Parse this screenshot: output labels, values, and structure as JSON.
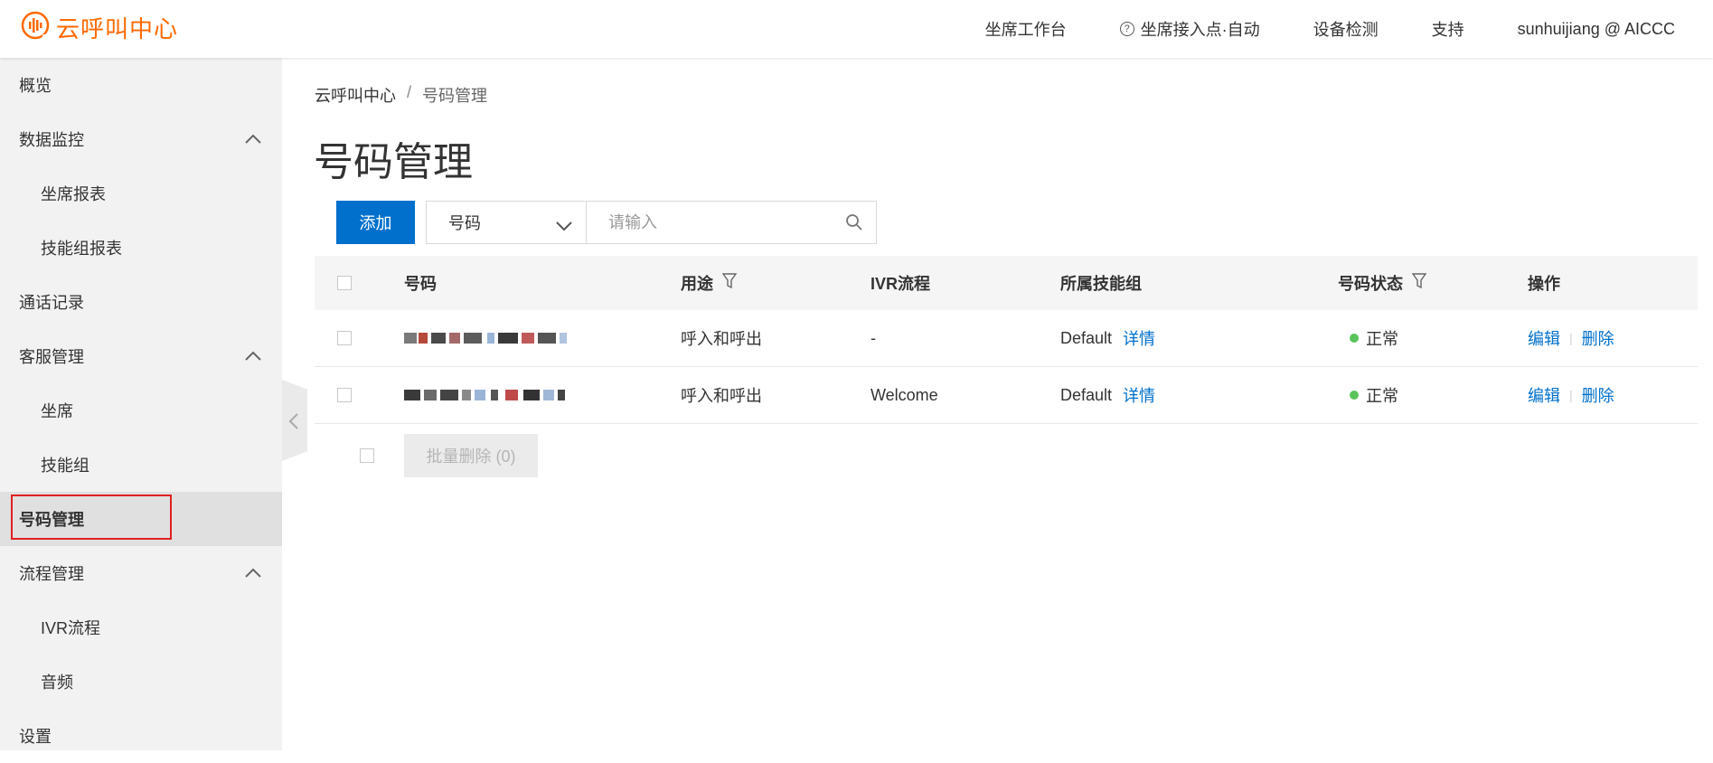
{
  "header": {
    "logo_text": "云呼叫中心",
    "brand_color": "#ff6a00",
    "nav": [
      "坐席工作台",
      "坐席接入点·自动",
      "设备检测",
      "支持",
      "sunhuijiang @ AICCC"
    ]
  },
  "sidebar": {
    "items": [
      {
        "label": "概览",
        "level": 1
      },
      {
        "label": "数据监控",
        "level": 1,
        "expanded": true
      },
      {
        "label": "坐席报表",
        "level": 2
      },
      {
        "label": "技能组报表",
        "level": 2
      },
      {
        "label": "通话记录",
        "level": 1
      },
      {
        "label": "客服管理",
        "level": 1,
        "expanded": true
      },
      {
        "label": "坐席",
        "level": 2
      },
      {
        "label": "技能组",
        "level": 2
      },
      {
        "label": "号码管理",
        "level": 1,
        "active": true
      },
      {
        "label": "流程管理",
        "level": 1,
        "expanded": true
      },
      {
        "label": "IVR流程",
        "level": 2
      },
      {
        "label": "音频",
        "level": 2
      },
      {
        "label": "设置",
        "level": 1
      }
    ]
  },
  "breadcrumb": {
    "root": "云呼叫中心",
    "separator": "/",
    "current": "号码管理"
  },
  "page_title": "号码管理",
  "toolbar": {
    "add_label": "添加",
    "filter_select_value": "号码",
    "search_placeholder": "请输入"
  },
  "table": {
    "columns": [
      "号码",
      "用途",
      "IVR流程",
      "所属技能组",
      "号码状态",
      "操作"
    ],
    "rows": [
      {
        "number": "",
        "usage": "呼入和呼出",
        "ivr": "-",
        "skill_group": "Default",
        "detail": "详情",
        "status": "正常",
        "edit": "编辑",
        "delete": "删除"
      },
      {
        "number": "",
        "usage": "呼入和呼出",
        "ivr": "Welcome",
        "skill_group": "Default",
        "detail": "详情",
        "status": "正常",
        "edit": "编辑",
        "delete": "删除"
      }
    ]
  },
  "batch_delete_label": "批量删除 (0)",
  "colors": {
    "primary": "#0070cc",
    "status_ok": "#5ac35a",
    "highlight_box": "#e02020"
  }
}
